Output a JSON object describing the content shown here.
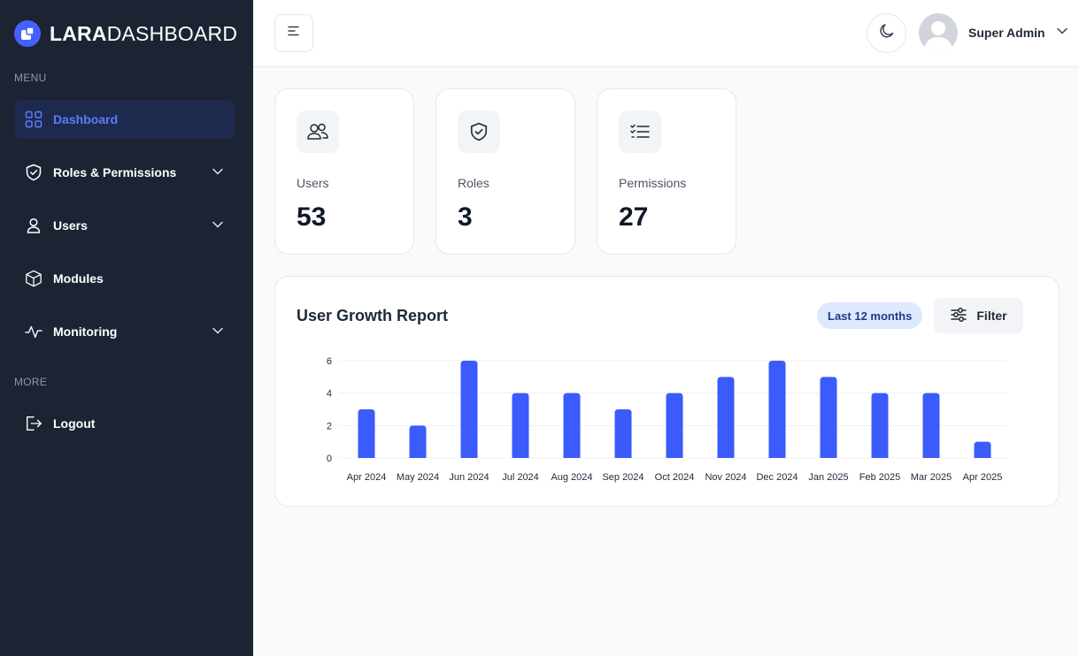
{
  "brand": {
    "bold": "LARA",
    "light": "DASHBOARD"
  },
  "sidebar": {
    "menu_label": "MENU",
    "more_label": "MORE",
    "items": [
      {
        "label": "Dashboard",
        "icon": "grid-icon",
        "active": true
      },
      {
        "label": "Roles & Permissions",
        "icon": "shield-icon",
        "has_submenu": true
      },
      {
        "label": "Users",
        "icon": "user-icon",
        "has_submenu": true
      },
      {
        "label": "Modules",
        "icon": "cube-icon"
      },
      {
        "label": "Monitoring",
        "icon": "activity-icon",
        "has_submenu": true
      }
    ],
    "more_items": [
      {
        "label": "Logout",
        "icon": "logout-icon"
      }
    ]
  },
  "header": {
    "user_name": "Super Admin"
  },
  "stats": [
    {
      "label": "Users",
      "value": "53",
      "icon": "users-icon"
    },
    {
      "label": "Roles",
      "value": "3",
      "icon": "shield-check-icon"
    },
    {
      "label": "Permissions",
      "value": "27",
      "icon": "list-check-icon"
    }
  ],
  "chart_card": {
    "title": "User Growth Report",
    "range_badge": "Last 12 months",
    "filter_label": "Filter"
  },
  "colors": {
    "accent": "#3b5bfd",
    "sidebar_bg": "#1c2434",
    "active_nav_bg": "#1e2a4d",
    "badge_bg": "#dde9ff"
  },
  "chart_data": {
    "type": "bar",
    "categories": [
      "Apr 2024",
      "May 2024",
      "Jun 2024",
      "Jul 2024",
      "Aug 2024",
      "Sep 2024",
      "Oct 2024",
      "Nov 2024",
      "Dec 2024",
      "Jan 2025",
      "Feb 2025",
      "Mar 2025",
      "Apr 2025"
    ],
    "values": [
      3,
      2,
      6,
      4,
      4,
      3,
      4,
      5,
      6,
      5,
      4,
      4,
      1
    ],
    "yticks": [
      0,
      2,
      4,
      6
    ],
    "ylim": [
      0,
      6
    ],
    "grid": true
  }
}
